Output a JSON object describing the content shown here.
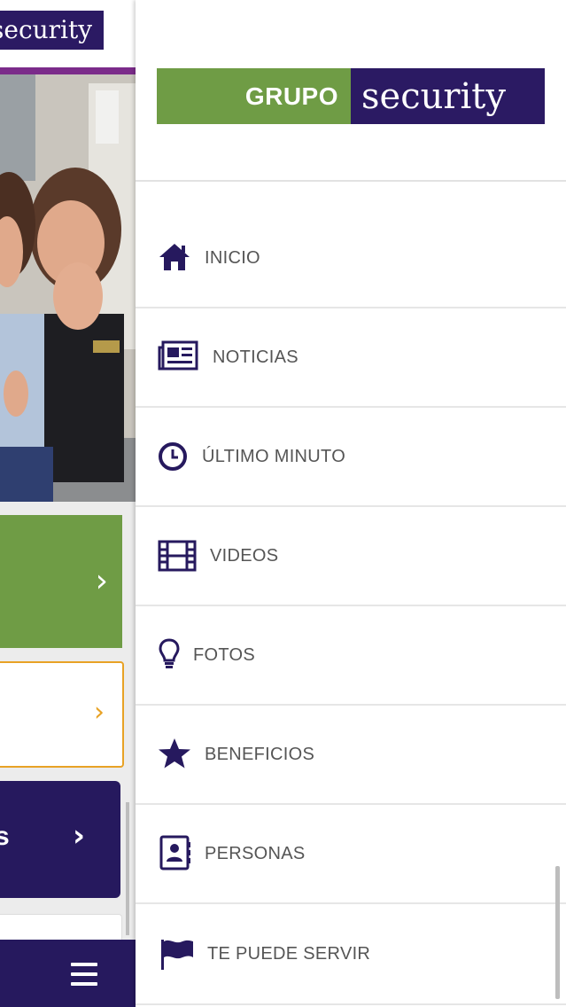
{
  "background_screen": {
    "logo_text": "security",
    "colors": {
      "navy": "#26195e",
      "green": "#6f9c45",
      "orange": "#e8a225",
      "purple": "#7b2b8a"
    }
  },
  "drawer": {
    "brand": {
      "left": "GRUPO",
      "right": "security"
    },
    "items": [
      {
        "label": "INICIO",
        "icon": "home-icon"
      },
      {
        "label": "NOTICIAS",
        "icon": "newspaper-icon"
      },
      {
        "label": "ÚLTIMO MINUTO",
        "icon": "clock-icon"
      },
      {
        "label": "VIDEOS",
        "icon": "film-icon"
      },
      {
        "label": "FOTOS",
        "icon": "lightbulb-icon"
      },
      {
        "label": "BENEFICIOS",
        "icon": "star-icon"
      },
      {
        "label": "PERSONAS",
        "icon": "contact-book-icon"
      },
      {
        "label": "TE PUEDE SERVIR",
        "icon": "flag-icon"
      }
    ]
  }
}
